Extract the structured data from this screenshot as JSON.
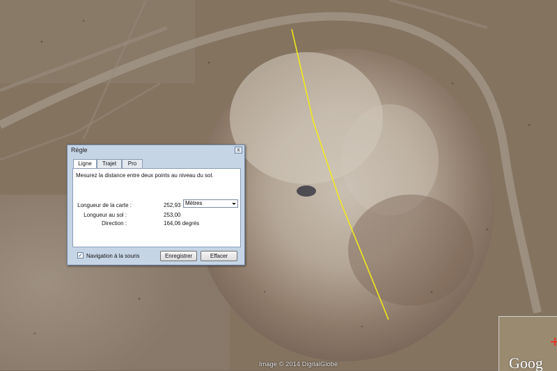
{
  "map": {
    "credit": "Image © 2014 DigitalGlobe",
    "overview_logo": "Goog",
    "measure_line_color": "#f2ea1a"
  },
  "dialog": {
    "title": "Règle",
    "close_glyph": "x",
    "tabs": [
      {
        "label": "Ligne",
        "active": true
      },
      {
        "label": "Trajet",
        "active": false
      },
      {
        "label": "Pro",
        "active": false
      }
    ],
    "description": "Mesurez la distance entre deux points au niveau du sol.",
    "map_length_label": "Longueur de la carte :",
    "map_length_value": "252,93",
    "unit": "Mètres",
    "ground_length_label": "Longueur au sol :",
    "ground_length_value": "253,00",
    "direction_label": "Direction :",
    "direction_value": "164,06 degrés",
    "mouse_nav_label": "Navigation à la souris",
    "mouse_nav_checked": true,
    "save_label": "Enregistrer",
    "clear_label": "Effacer"
  }
}
